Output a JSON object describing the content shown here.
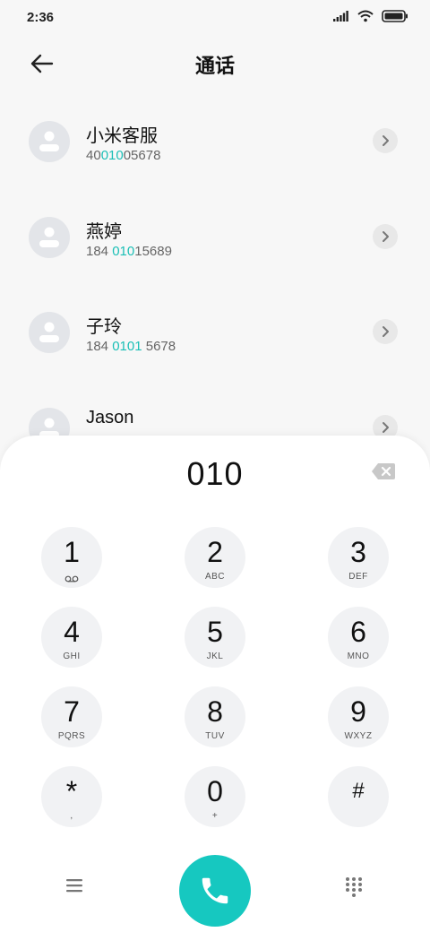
{
  "status": {
    "time": "2:36"
  },
  "header": {
    "title": "通话"
  },
  "contacts": [
    {
      "name": "小米客服",
      "num_pre": "40",
      "num_hl": "010",
      "num_post": "05678"
    },
    {
      "name": "燕婷",
      "num_pre": "184 ",
      "num_hl": "010",
      "num_post": "15689"
    },
    {
      "name": "子玲",
      "num_pre": "184 ",
      "num_hl": "0101",
      "num_post": " 5678"
    },
    {
      "name": "Jason",
      "num_pre": "",
      "num_hl": "",
      "num_post": ""
    }
  ],
  "dialer": {
    "entry": "010",
    "keys": [
      {
        "digit": "1",
        "letters": ""
      },
      {
        "digit": "2",
        "letters": "ABC"
      },
      {
        "digit": "3",
        "letters": "DEF"
      },
      {
        "digit": "4",
        "letters": "GHI"
      },
      {
        "digit": "5",
        "letters": "JKL"
      },
      {
        "digit": "6",
        "letters": "MNO"
      },
      {
        "digit": "7",
        "letters": "PQRS"
      },
      {
        "digit": "8",
        "letters": "TUV"
      },
      {
        "digit": "9",
        "letters": "WXYZ"
      },
      {
        "digit": "*",
        "letters": ","
      },
      {
        "digit": "0",
        "letters": "+"
      },
      {
        "digit": "#",
        "letters": ""
      }
    ]
  },
  "icons": {
    "back": "arrow-left-icon",
    "chevron": "chevron-right-icon",
    "backspace": "backspace-icon",
    "call": "phone-icon",
    "menu": "hamburger-menu-icon",
    "keypad": "keypad-grid-icon",
    "voicemail": "voicemail-icon"
  },
  "colors": {
    "accent": "#16c8c0",
    "highlight": "#1bbfb6"
  }
}
